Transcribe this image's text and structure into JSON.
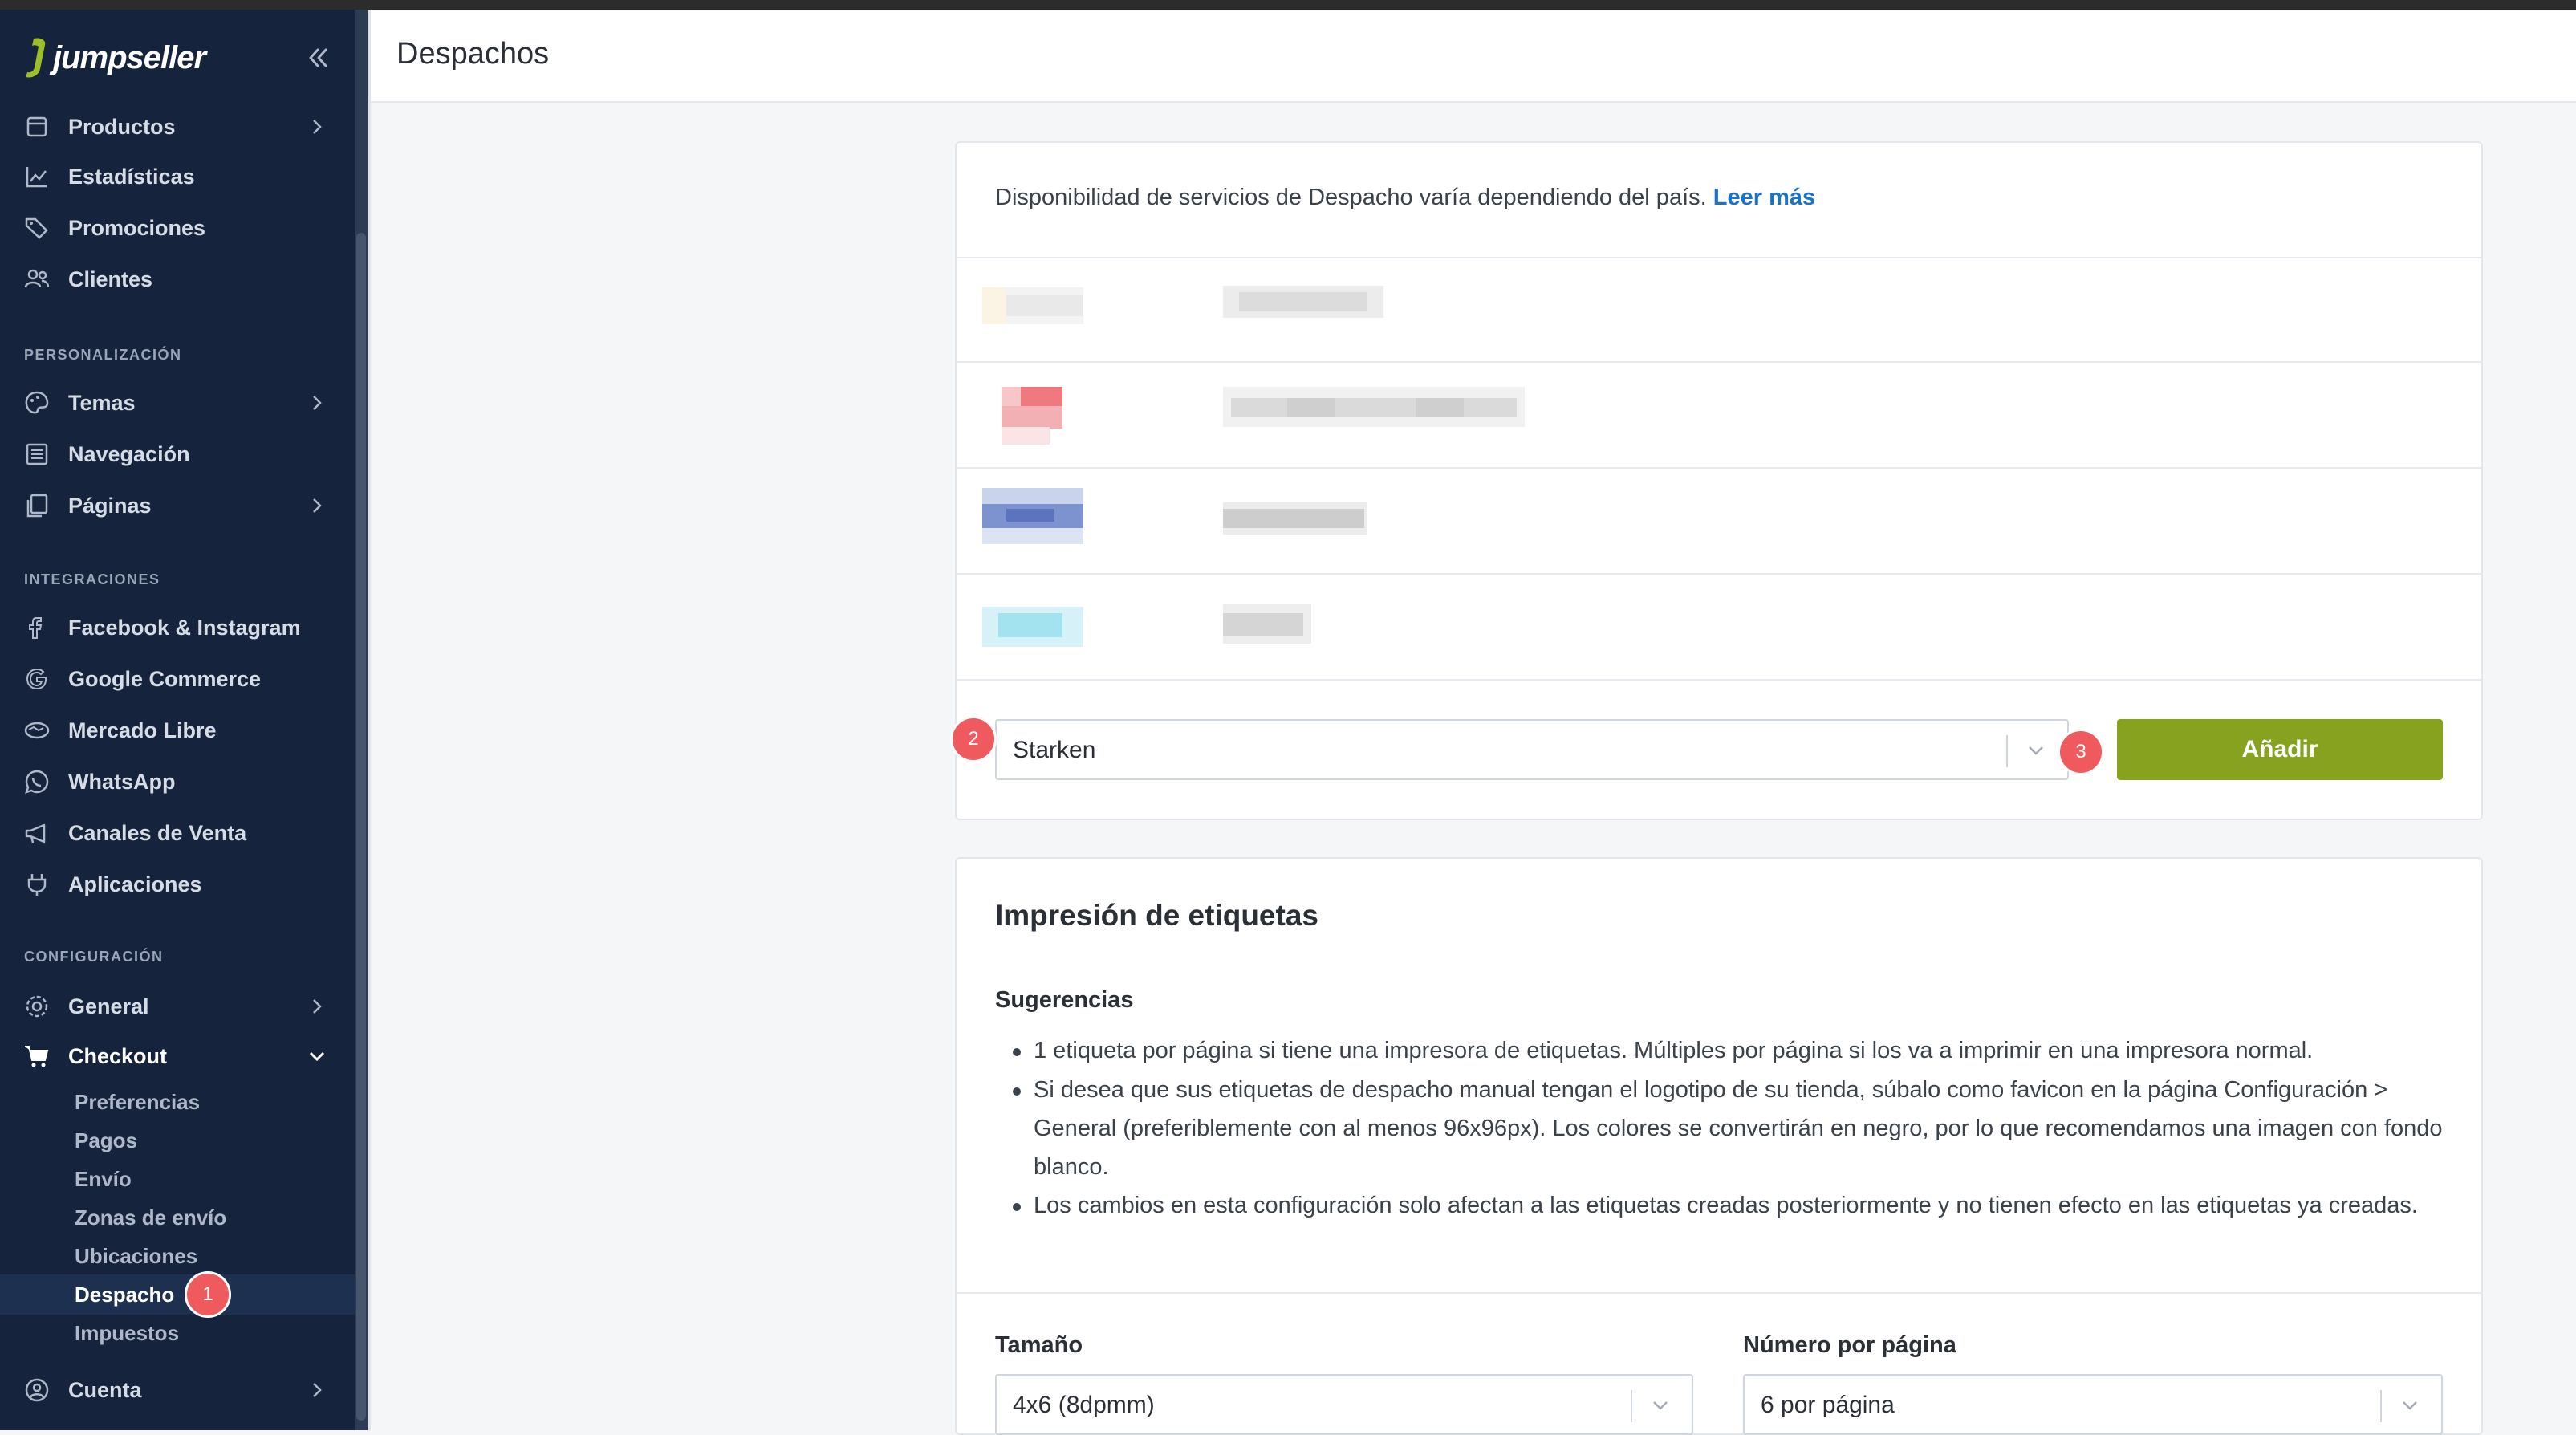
{
  "app": {
    "brand": "jumpseller"
  },
  "sidebar": {
    "main_items": [
      {
        "label": "Productos",
        "icon": "box-icon",
        "has_children": true
      },
      {
        "label": "Estadísticas",
        "icon": "chart-line-icon",
        "has_children": false
      },
      {
        "label": "Promociones",
        "icon": "tags-icon",
        "has_children": false
      },
      {
        "label": "Clientes",
        "icon": "users-icon",
        "has_children": false
      }
    ],
    "sections": {
      "personalizacion": "PERSONALIZACIÓN",
      "integraciones": "INTEGRACIONES",
      "configuracion": "CONFIGURACIÓN"
    },
    "personalizacion_items": [
      {
        "label": "Temas",
        "icon": "palette-icon",
        "has_children": true
      },
      {
        "label": "Navegación",
        "icon": "list-icon",
        "has_children": false
      },
      {
        "label": "Páginas",
        "icon": "pages-icon",
        "has_children": true
      }
    ],
    "integraciones_items": [
      {
        "label": "Facebook & Instagram",
        "icon": "facebook-icon"
      },
      {
        "label": "Google Commerce",
        "icon": "google-icon"
      },
      {
        "label": "Mercado Libre",
        "icon": "handshake-icon"
      },
      {
        "label": "WhatsApp",
        "icon": "whatsapp-icon"
      },
      {
        "label": "Canales de Venta",
        "icon": "megaphone-icon"
      },
      {
        "label": "Aplicaciones",
        "icon": "plug-icon"
      }
    ],
    "configuracion_items": [
      {
        "label": "General",
        "icon": "gear-icon",
        "has_children": true
      },
      {
        "label": "Checkout",
        "icon": "cart-icon",
        "expanded": true
      }
    ],
    "checkout_subitems": [
      "Preferencias",
      "Pagos",
      "Envío",
      "Zonas de envío",
      "Ubicaciones",
      "Despacho",
      "Impuestos"
    ],
    "active_subitem": "Despacho",
    "account": {
      "label": "Cuenta",
      "icon": "user-circle-icon"
    }
  },
  "header": {
    "title": "Despachos"
  },
  "despacho": {
    "availability_text": "Disponibilidad de servicios de Despacho varía dependiendo del país.",
    "read_more": "Leer más",
    "selected_service": "Starken",
    "add_button": "Añadir"
  },
  "etiquetas": {
    "title": "Impresión de etiquetas",
    "suggestions_title": "Sugerencias",
    "bullets": [
      "1 etiqueta por página si tiene una impresora de etiquetas. Múltiples por página si los va a imprimir en una impresora normal.",
      "Si desea que sus etiquetas de despacho manual tengan el logotipo de su tienda, súbalo como favicon en la página Configuración > General (preferiblemente con al menos 96x96px). Los colores se convertirán en negro, por lo que recomendamos una imagen con fondo blanco.",
      "Los cambios en esta configuración solo afectan a las etiquetas creadas posteriormente y no tienen efecto en las etiquetas ya creadas."
    ],
    "size_label": "Tamaño",
    "size_value": "4x6 (8dpmm)",
    "per_page_label": "Número por página",
    "per_page_value": "6 por página"
  },
  "annotations": [
    "1",
    "2",
    "3"
  ],
  "colors": {
    "sidebar": "#15233d",
    "accent_button": "#86a21f",
    "link": "#1a73c9",
    "badge": "#ef5a5f"
  }
}
